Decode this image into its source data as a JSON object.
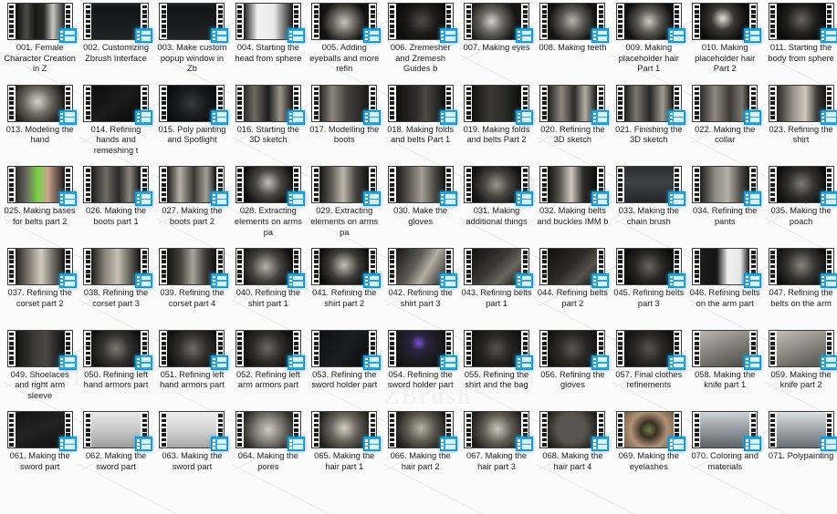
{
  "window": {
    "view_mode": "medium-icons-thumbnail-grid",
    "item_type": "video-file",
    "columns": 11,
    "rows": 6
  },
  "icons": {
    "file_badge": "video-file-icon",
    "thumbnail": "filmstrip-thumbnail-icon"
  },
  "colors": {
    "badge_blue": "#28a6dd",
    "badge_blue_dark": "#1c8cbd",
    "badge_frame_light": "#d8f1fb",
    "background": "#fbfbfb",
    "caption_text": "#1d1d1d",
    "filmstrip_dark": "#111111",
    "filmstrip_sprocket": "#ffffff"
  },
  "watermark": {
    "text": "ZBrush",
    "visible": true
  },
  "items": [
    {
      "name": "001. Female Character Creation in Z",
      "scene": "two-figures-render"
    },
    {
      "name": "002. Customizing Zbrush Interface",
      "scene": "figure-ui"
    },
    {
      "name": "003. Make custom popup window in Zb",
      "scene": "figure-ui"
    },
    {
      "name": "004. Starting the head from sphere",
      "scene": "two-figures-white"
    },
    {
      "name": "005. Adding eyeballs and more refin",
      "scene": "head-bust"
    },
    {
      "name": "006. Zremesher and Zremesh Guides b",
      "scene": "dark-head"
    },
    {
      "name": "007. Making eyes",
      "scene": "bald-head-side"
    },
    {
      "name": "008. Making teeth",
      "scene": "head-front"
    },
    {
      "name": "009. Making placeholder hair Part 1",
      "scene": "head-front-detail"
    },
    {
      "name": "010. Making placeholder hair Part 2",
      "scene": "head-dark"
    },
    {
      "name": "011. Starting the body from sphere",
      "scene": "dark-torso"
    },
    {
      "name": "013. Modeling the hand",
      "scene": "torso-front"
    },
    {
      "name": "014. Refining hands and remeshing t",
      "scene": "dark-scene"
    },
    {
      "name": "015. Poly painting and Spotlight",
      "scene": "full-body-dark"
    },
    {
      "name": "016. Starting the 3D sketch",
      "scene": "figure-reference"
    },
    {
      "name": "017. Modelling the boots",
      "scene": "figure-bust"
    },
    {
      "name": "018. Making folds and belts Part 1",
      "scene": "dark-legs"
    },
    {
      "name": "019. Making folds and belts Part 2",
      "scene": "dark-legs-2"
    },
    {
      "name": "020. Refining the 3D sketch",
      "scene": "figure-standing"
    },
    {
      "name": "021. Finishing the 3D sketch",
      "scene": "figure-standing-2"
    },
    {
      "name": "022. Making the collar",
      "scene": "clothing-detail"
    },
    {
      "name": "023. Refining the shirt",
      "scene": "clothing-front"
    },
    {
      "name": "025. Making bases for belts part 2",
      "scene": "green-top-figure"
    },
    {
      "name": "026. Making the boots part 1",
      "scene": "legs-boots"
    },
    {
      "name": "027. Making the boots part 2",
      "scene": "legs-boots-2"
    },
    {
      "name": "028. Extracting elements on arms pa",
      "scene": "body-arms"
    },
    {
      "name": "029. Extracting elements on arms pa",
      "scene": "arm-panels"
    },
    {
      "name": "030. Make the gloves",
      "scene": "gloves-arms"
    },
    {
      "name": "031. Making additional things",
      "scene": "figure-pose"
    },
    {
      "name": "032. Making belts and buckles IMM b",
      "scene": "two-figures-dark"
    },
    {
      "name": "033. Making the chain brush",
      "scene": "chain-brush-ui"
    },
    {
      "name": "034. Refining the pants",
      "scene": "pants-legs"
    },
    {
      "name": "035. Making the poach",
      "scene": "figure-poach"
    },
    {
      "name": "037. Refining the corset part 2",
      "scene": "corset-figure"
    },
    {
      "name": "038. Refining the corset part 3",
      "scene": "corset-figure-2"
    },
    {
      "name": "039. Refining the corset part 4",
      "scene": "corset-back"
    },
    {
      "name": "040. Refining the shirt part 1",
      "scene": "shirt-detail"
    },
    {
      "name": "041. Refining the shirt part 2",
      "scene": "shirt-back"
    },
    {
      "name": "042. Refining the shirt part 3",
      "scene": "shirt-arm"
    },
    {
      "name": "043. Refining belts part 1",
      "scene": "belts-detail"
    },
    {
      "name": "044. Refining belts part 2",
      "scene": "belts-detail-2"
    },
    {
      "name": "045. Refining belts part 3",
      "scene": "belts-detail-3"
    },
    {
      "name": "046. Refining belts on the arm part",
      "scene": "reference-two-figures"
    },
    {
      "name": "047. Refining the belts on the arm",
      "scene": "figure-dress"
    },
    {
      "name": "049. Shoelaces and right arm sleeve",
      "scene": "legs-dark"
    },
    {
      "name": "050. Refining left hand armors part",
      "scene": "full-body"
    },
    {
      "name": "051. Refining left hand armors part",
      "scene": "full-body-2"
    },
    {
      "name": "052. Refining left arm armors part",
      "scene": "body-side"
    },
    {
      "name": "053. Refining the sword holder part",
      "scene": "dark-sword"
    },
    {
      "name": "054. Refining the sword holder part",
      "scene": "sword-purple-glow"
    },
    {
      "name": "055. Refining the shirt and the bag",
      "scene": "figure-small"
    },
    {
      "name": "056. Refining the gloves",
      "scene": "figure-small-2"
    },
    {
      "name": "057. Final clothes refinements",
      "scene": "figure-small-3"
    },
    {
      "name": "058. Making the knife part 1",
      "scene": "knife-model"
    },
    {
      "name": "059. Making the knife part 2",
      "scene": "knife-model-2"
    },
    {
      "name": "061. Making the sword part",
      "scene": "sword-dark"
    },
    {
      "name": "062. Making the sword part",
      "scene": "sword-light"
    },
    {
      "name": "063. Making the sword part",
      "scene": "sword-light-2"
    },
    {
      "name": "064. Making the pores",
      "scene": "figure-pores"
    },
    {
      "name": "065. Making the hair part 1",
      "scene": "hair-head"
    },
    {
      "name": "066. Making the hair part 2",
      "scene": "hair-head-2"
    },
    {
      "name": "067. Making the hair part 3",
      "scene": "hair-head-3"
    },
    {
      "name": "068. Making the hair part 4",
      "scene": "hair-head-4"
    },
    {
      "name": "069. Making the eyelashes",
      "scene": "eye-closeup"
    },
    {
      "name": "070. Coloring and materials",
      "scene": "colored-character"
    },
    {
      "name": "071. Polypainting",
      "scene": "character-arms-out"
    }
  ]
}
